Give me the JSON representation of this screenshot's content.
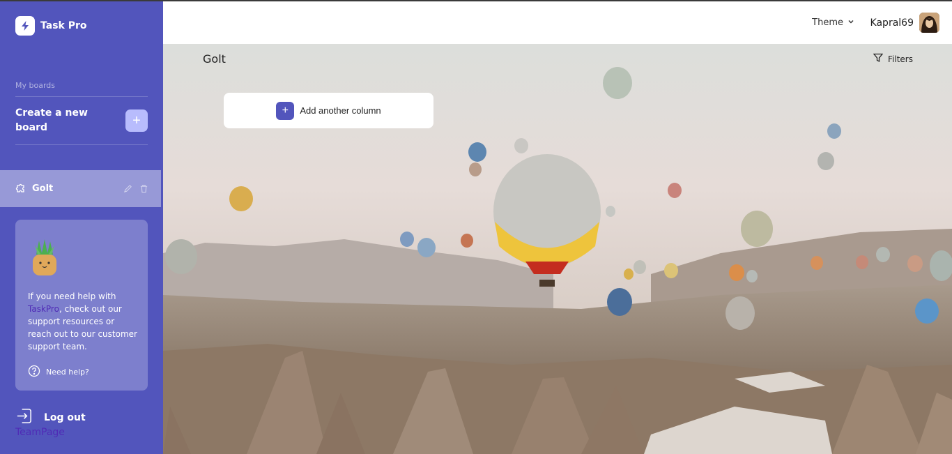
{
  "app": {
    "name": "Task Pro"
  },
  "sidebar": {
    "section_label": "My boards",
    "create_label": "Create a new board",
    "create_button": "+",
    "boards": [
      {
        "name": "Golt",
        "active": true
      }
    ],
    "help": {
      "text_before": "If you need help with ",
      "highlight": "TaskPro",
      "text_after": ", check out our support resources or reach out to our customer support team.",
      "link": "Need help?"
    },
    "logout": "Log out",
    "team_page": "TeamPage"
  },
  "header": {
    "theme_label": "Theme",
    "username": "Kapral69"
  },
  "board": {
    "title": "Golt",
    "filters_label": "Filters",
    "add_column_label": "Add another column"
  },
  "colors": {
    "sidebar": "#5255bc",
    "accent": "#5255bc",
    "create_button": "#b8bcfd"
  },
  "icons": {
    "logo": "lightning-icon",
    "board": "puzzle-icon",
    "edit": "pencil-icon",
    "delete": "trash-icon",
    "help": "question-circle-icon",
    "logout": "logout-icon",
    "theme": "chevron-down-icon",
    "filters": "filter-icon"
  }
}
